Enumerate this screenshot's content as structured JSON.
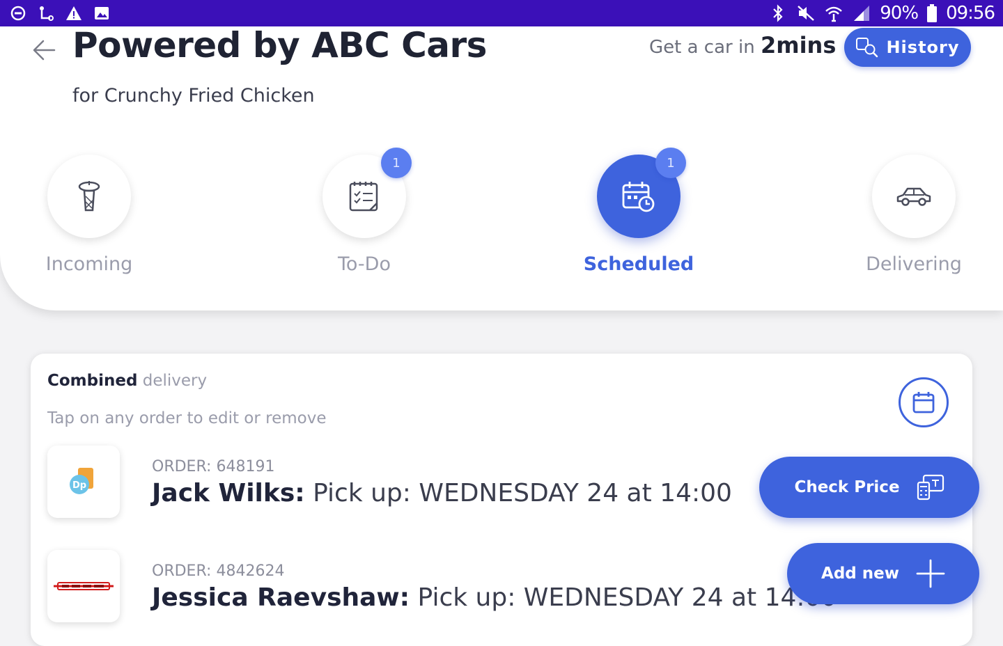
{
  "status_bar": {
    "left_icons": [
      "do-not-disturb-icon",
      "route-icon",
      "warning-icon",
      "image-icon"
    ],
    "right_icons": [
      "bluetooth-icon",
      "mute-icon",
      "wifi-icon",
      "signal-icon",
      "battery-icon"
    ],
    "battery": "90%",
    "time": "09:56"
  },
  "header": {
    "title": "Powered by ABC Cars",
    "subtitle": "for Crunchy Fried Chicken",
    "eta_prefix": "Get a car in",
    "eta_value": "2mins",
    "history_label": "History"
  },
  "tabs": [
    {
      "label": "Incoming",
      "icon": "incoming-icon",
      "badge": "",
      "active": false
    },
    {
      "label": "To-Do",
      "icon": "todo-list-icon",
      "badge": "1",
      "active": false
    },
    {
      "label": "Scheduled",
      "icon": "calendar-clock-icon",
      "badge": "1",
      "active": true
    },
    {
      "label": "Delivering",
      "icon": "car-icon",
      "badge": "",
      "active": false
    }
  ],
  "combined": {
    "title_bold": "Combined",
    "title_rest": "delivery",
    "hint": "Tap on any order to edit or remove",
    "orders": [
      {
        "order_no": "ORDER: 648191",
        "name": "Jack Wilks:",
        "pickup": "Pick up:  WEDNESDAY 24 at 14:00",
        "logo": "dp-logo"
      },
      {
        "order_no": "ORDER: 4842624",
        "name": "Jessica Raevshaw:",
        "pickup": "Pick up:  WEDNESDAY 24 at 14:00",
        "logo": "red-brand-logo"
      }
    ]
  },
  "actions": {
    "check_price": "Check Price",
    "add_new": "Add new"
  },
  "colors": {
    "status_bar": "#3b10b8",
    "accent": "#3e63dd",
    "badge": "#5b7ef0"
  }
}
